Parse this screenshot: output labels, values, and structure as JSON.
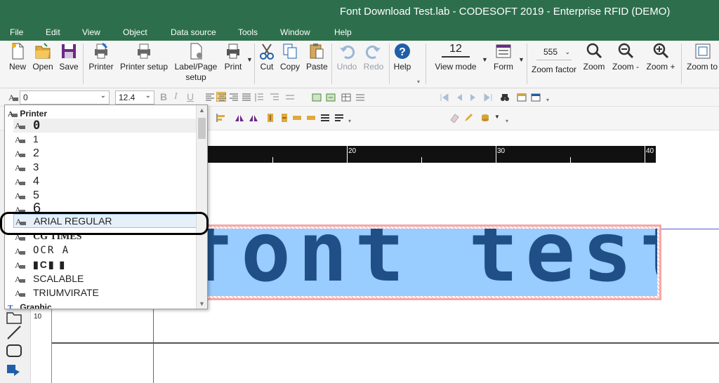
{
  "window": {
    "title": "Font Download Test.lab - CODESOFT 2019 - Enterprise RFID (DEMO)"
  },
  "menu": [
    "File",
    "Edit",
    "View",
    "Object",
    "Data source",
    "Tools",
    "Window",
    "Help"
  ],
  "ribbon": {
    "new": "New",
    "open": "Open",
    "save": "Save",
    "printer": "Printer",
    "printer_setup": "Printer setup",
    "label_page_setup_1": "Label/Page",
    "label_page_setup_2": "setup",
    "print": "Print",
    "cut": "Cut",
    "copy": "Copy",
    "paste": "Paste",
    "undo": "Undo",
    "redo": "Redo",
    "help": "Help",
    "view_mode_value": "12",
    "view_mode": "View mode",
    "form": "Form",
    "zoom_factor_value": "555",
    "zoom_factor": "Zoom factor",
    "zoom": "Zoom",
    "zoom_minus": "Zoom -",
    "zoom_plus": "Zoom +",
    "zoom_to": "Zoom to"
  },
  "format": {
    "font_value": "0",
    "font_size": "12.4",
    "bold": "B",
    "italic": "I",
    "underline": "U"
  },
  "ruler": {
    "marks": [
      "20",
      "30",
      "40"
    ],
    "vertical_mark": "10"
  },
  "canvas": {
    "text": "font test"
  },
  "font_dropdown": {
    "group_printer": "Printer",
    "group_graphic": "Graphic",
    "items": [
      "0",
      "1",
      "2",
      "3",
      "4",
      "5",
      "6",
      "ARIAL REGULAR",
      "CG TIMES",
      "OCR A",
      "▮C▮ ▮",
      "SCALABLE",
      "TRIUMVIRATE"
    ],
    "selected": "ARIAL REGULAR"
  },
  "colors": {
    "title_bar": "#2d6f4c",
    "text_object_fill": "#99ccff",
    "text_object_ink": "#1f4f86",
    "selection_border": "#f5a8a8"
  }
}
